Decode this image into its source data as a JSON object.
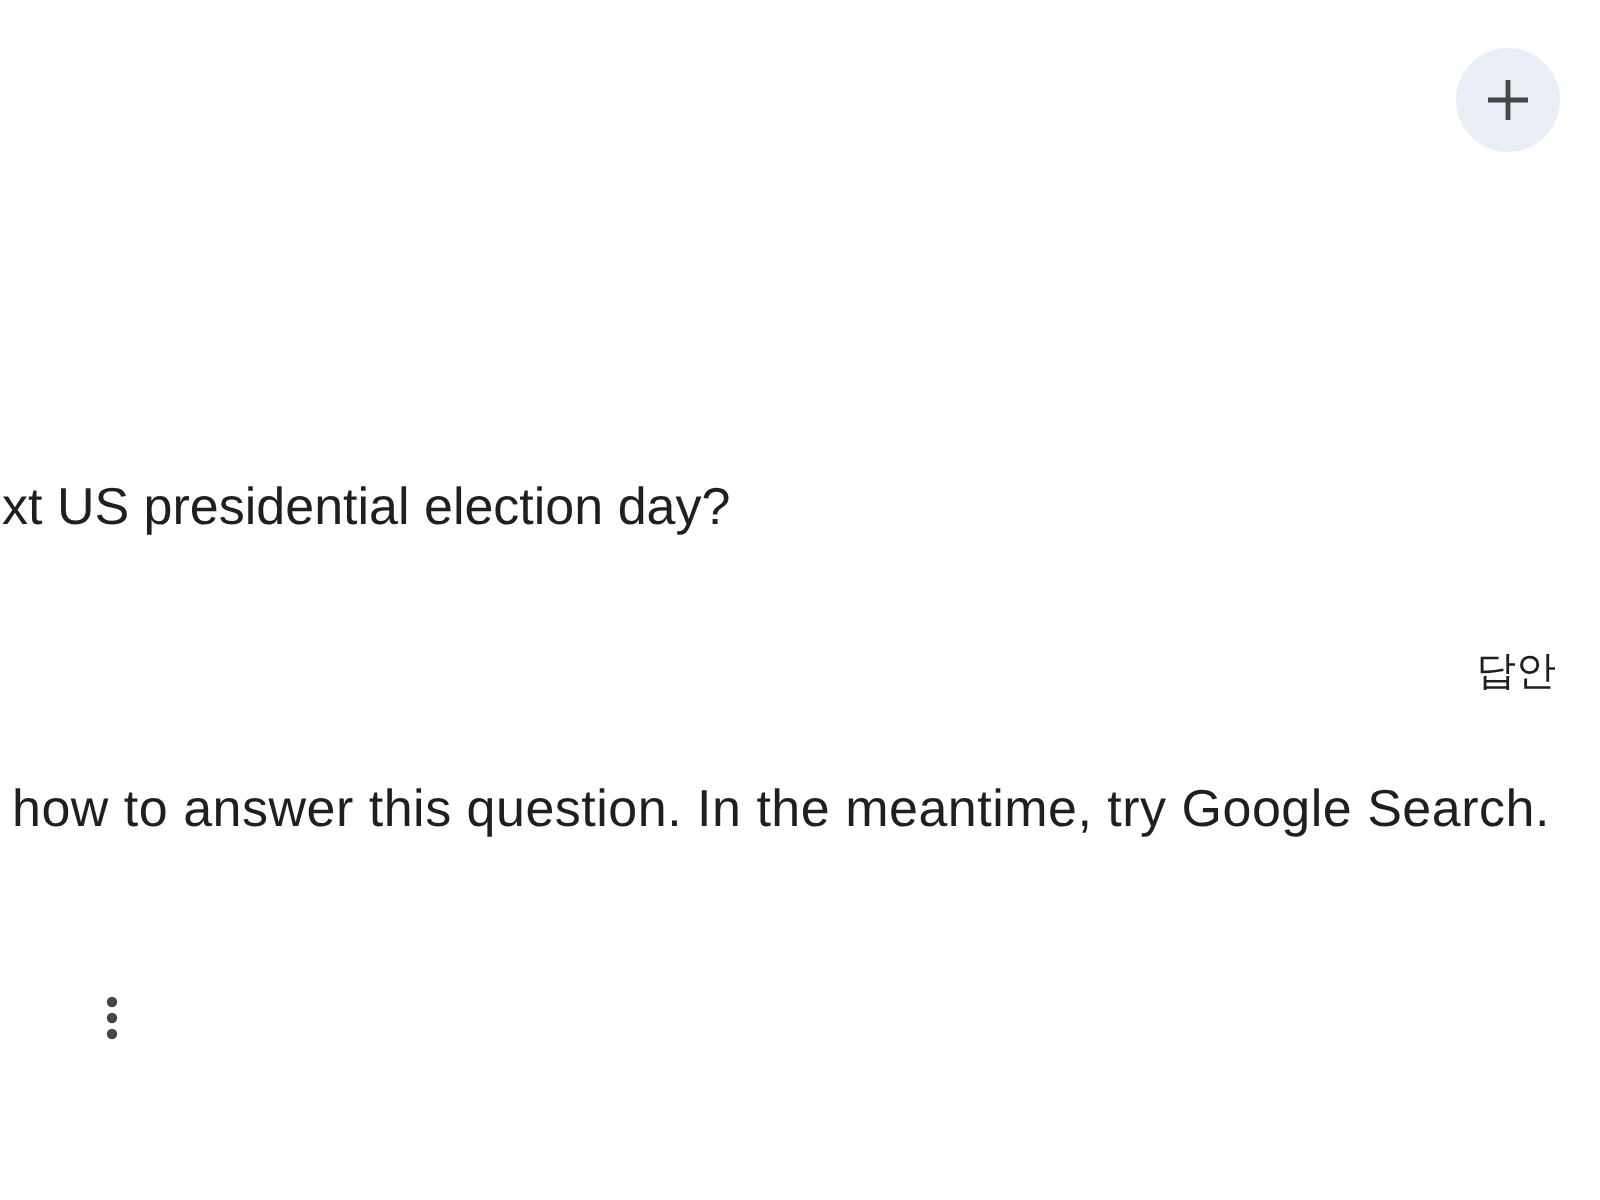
{
  "prompt": {
    "text": "xt US presidential election day?"
  },
  "drafts_toggle": {
    "label": "답안"
  },
  "response": {
    "text": "how to answer this question. In the meantime, try Google Search."
  }
}
